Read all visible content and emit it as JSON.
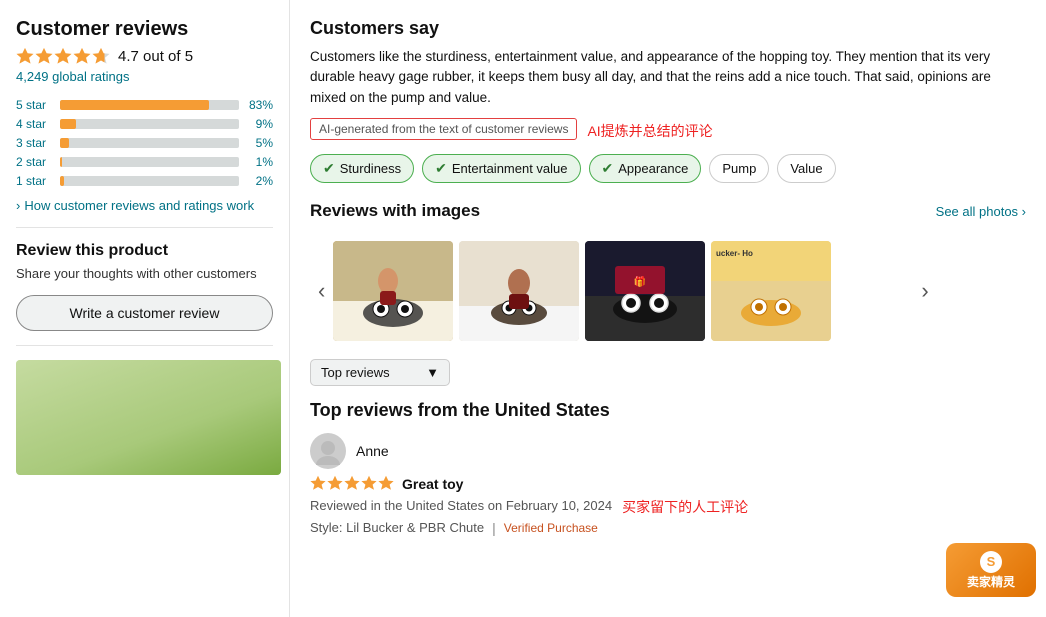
{
  "left": {
    "section_title": "Customer reviews",
    "rating_value": "4.7",
    "rating_max": "out of 5",
    "global_ratings": "4,249 global ratings",
    "bars": [
      {
        "label": "5 star",
        "pct": 83,
        "pct_text": "83%"
      },
      {
        "label": "4 star",
        "pct": 9,
        "pct_text": "9%"
      },
      {
        "label": "3 star",
        "pct": 5,
        "pct_text": "5%"
      },
      {
        "label": "2 star",
        "pct": 1,
        "pct_text": "1%"
      },
      {
        "label": "1 star",
        "pct": 2,
        "pct_text": "2%"
      }
    ],
    "how_link": "How customer reviews and ratings work",
    "review_product_title": "Review this product",
    "review_product_sub": "Share your thoughts with other customers",
    "write_review_btn": "Write a customer review"
  },
  "right": {
    "customers_say_title": "Customers say",
    "customers_say_text": "Customers like the sturdiness, entertainment value, and appearance of the hopping toy. They mention that its very durable heavy gage rubber, it keeps them busy all day, and that the reins add a nice touch. That said, opinions are mixed on the pump and value.",
    "ai_badge_text": "AI-generated from the text of customer reviews",
    "ai_label": "AI提炼并总结的评论",
    "tags": [
      {
        "label": "Sturdiness",
        "active": true
      },
      {
        "label": "Entertainment value",
        "active": true
      },
      {
        "label": "Appearance",
        "active": true
      },
      {
        "label": "Pump",
        "active": false
      },
      {
        "label": "Value",
        "active": false
      }
    ],
    "reviews_images_title": "Reviews with images",
    "see_all_photos": "See all photos ›",
    "top_reviews_dropdown": "Top reviews",
    "top_reviews_from_title": "Top reviews from the United States",
    "reviewer_name": "Anne",
    "review_title": "Great toy",
    "review_meta": "Reviewed in the United States on February 10, 2024",
    "review_style": "Style: Lil Bucker & PBR Chute",
    "verified": "Verified Purchase",
    "buyer_label": "买家留下的人工评论"
  },
  "seller_widget": {
    "icon": "S",
    "text": "卖家精灵"
  }
}
